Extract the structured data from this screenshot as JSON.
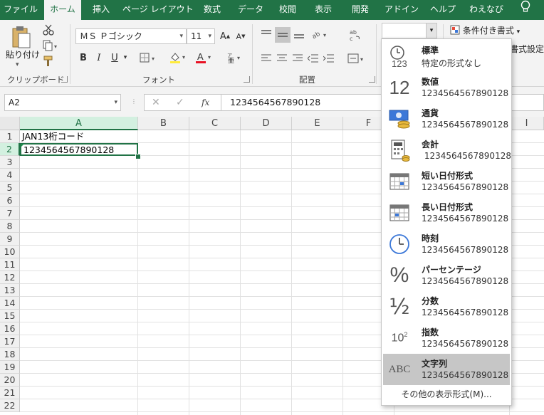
{
  "ribbon_tabs": [
    "ファイル",
    "ホーム",
    "挿入",
    "ページ レイアウト",
    "数式",
    "データ",
    "校閲",
    "表示",
    "開発",
    "アドイン",
    "ヘルプ",
    "わえなび"
  ],
  "active_tab": "ホーム",
  "clipboard": {
    "paste_label": "貼り付け",
    "group_label": "クリップボード"
  },
  "font": {
    "name": "ＭＳ Ｐゴシック",
    "size": "11",
    "group_label": "フォント",
    "bold": "B",
    "italic": "I",
    "underline": "U",
    "font_color": "#e81123",
    "fill_color": "#ffeb3b"
  },
  "alignment": {
    "group_label": "配置"
  },
  "styles": {
    "conditional": "条件付き書式",
    "cell_format": "書式設定"
  },
  "name_box": "A2",
  "formula_value": "1234564567890128",
  "columns": [
    "A",
    "B",
    "C",
    "D",
    "E",
    "F",
    "I"
  ],
  "selected_column": "A",
  "rows": [
    "1",
    "2",
    "3",
    "4",
    "5",
    "6",
    "7",
    "8",
    "9",
    "10",
    "11",
    "12",
    "13",
    "14",
    "15",
    "16",
    "17",
    "18",
    "19",
    "20",
    "21",
    "22"
  ],
  "selected_row": "2",
  "cells": {
    "A1": "JAN13桁コード",
    "A2": "1234564567890128"
  },
  "accent_color": "#217346",
  "number_formats": [
    {
      "name": "標準",
      "value": "特定の形式なし",
      "icon": "clock-123-icon"
    },
    {
      "name": "数値",
      "value": "1234564567890128",
      "icon": "number-12-icon"
    },
    {
      "name": "通貨",
      "value": "1234564567890128",
      "icon": "currency-icon"
    },
    {
      "name": "会計",
      "value": " 1234564567890128",
      "icon": "accounting-calculator-icon"
    },
    {
      "name": "短い日付形式",
      "value": "1234564567890128",
      "icon": "calendar-icon"
    },
    {
      "name": "長い日付形式",
      "value": "1234564567890128",
      "icon": "calendar-long-icon"
    },
    {
      "name": "時刻",
      "value": "1234564567890128",
      "icon": "clock-icon"
    },
    {
      "name": "パーセンテージ",
      "value": "1234564567890128",
      "icon": "percent-icon"
    },
    {
      "name": "分数",
      "value": "1234564567890128",
      "icon": "fraction-icon"
    },
    {
      "name": "指数",
      "value": "1234564567890128",
      "icon": "scientific-icon"
    },
    {
      "name": "文字列",
      "value": "1234564567890128",
      "icon": "text-abc-icon"
    }
  ],
  "highlighted_format": "文字列",
  "more_formats": "その他の表示形式(M)..."
}
